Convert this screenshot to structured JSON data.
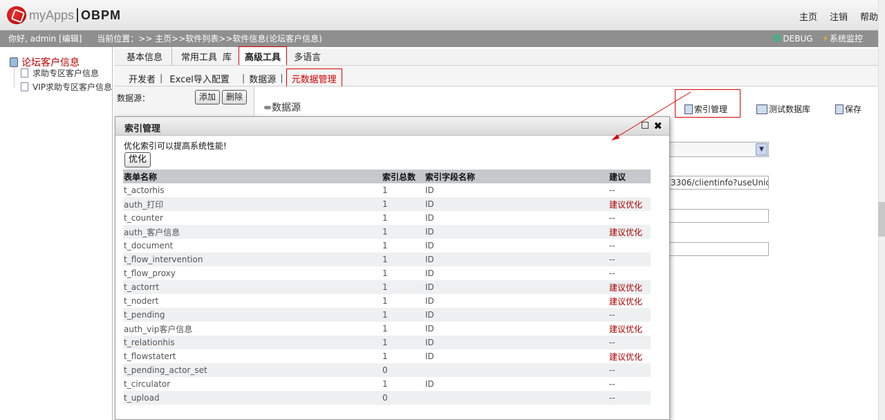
{
  "header": {
    "logo_main": "myApps",
    "logo_product": "OBPM",
    "links": [
      "主页",
      "注销",
      "帮助"
    ]
  },
  "infobar": {
    "greeting": "你好, admin [编辑]",
    "breadcrumb": "当前位置：>> 主页>>软件列表>>软件信息(论坛客户信息)",
    "debug_label": "DEBUG",
    "monitor_label": "系统监控"
  },
  "tree": {
    "root": "论坛客户信息",
    "children": [
      "求助专区客户信息",
      "VIP求助专区客户信息"
    ]
  },
  "tabs": {
    "items": [
      "基本信息",
      "常用工具",
      "库",
      "高级工具",
      "多语言"
    ],
    "active": "高级工具"
  },
  "subtabs": {
    "items": [
      "开发者",
      "Excel导入配置",
      "数据源",
      "元数据管理"
    ],
    "active": "元数据管理"
  },
  "datasource_panel": {
    "label": "数据源：",
    "add_label": "添加",
    "delete_label": "删除"
  },
  "toolbar": {
    "title": "数据源",
    "index_label": "索引管理",
    "test_label": "测试数据库",
    "save_label": "保存"
  },
  "form_bg": {
    "url_value": "3306/clientinfo?useUnicode"
  },
  "dialog": {
    "title": "索引管理",
    "hint": "优化索引可以提高系统性能!",
    "optimize_label": "优化",
    "columns": [
      "表单名称",
      "索引总数",
      "索引字段名称",
      "建议"
    ],
    "rows": [
      {
        "name": "t_actorhis",
        "count": "1",
        "field": "ID",
        "suggest": "--"
      },
      {
        "name": "auth_打印",
        "count": "1",
        "field": "ID",
        "suggest": "建议优化"
      },
      {
        "name": "t_counter",
        "count": "1",
        "field": "ID",
        "suggest": "--"
      },
      {
        "name": "auth_客户信息",
        "count": "1",
        "field": "ID",
        "suggest": "建议优化"
      },
      {
        "name": "t_document",
        "count": "1",
        "field": "ID",
        "suggest": "--"
      },
      {
        "name": "t_flow_intervention",
        "count": "1",
        "field": "ID",
        "suggest": "--"
      },
      {
        "name": "t_flow_proxy",
        "count": "1",
        "field": "ID",
        "suggest": "--"
      },
      {
        "name": "t_actorrt",
        "count": "1",
        "field": "ID",
        "suggest": "建议优化"
      },
      {
        "name": "t_nodert",
        "count": "1",
        "field": "ID",
        "suggest": "建议优化"
      },
      {
        "name": "t_pending",
        "count": "1",
        "field": "ID",
        "suggest": "--"
      },
      {
        "name": "auth_vip客户信息",
        "count": "1",
        "field": "ID",
        "suggest": "建议优化"
      },
      {
        "name": "t_relationhis",
        "count": "1",
        "field": "ID",
        "suggest": "--"
      },
      {
        "name": "t_flowstatert",
        "count": "1",
        "field": "ID",
        "suggest": "建议优化"
      },
      {
        "name": "t_pending_actor_set",
        "count": "0",
        "field": "",
        "suggest": "--"
      },
      {
        "name": "t_circulator",
        "count": "1",
        "field": "ID",
        "suggest": "--"
      },
      {
        "name": "t_upload",
        "count": "0",
        "field": "",
        "suggest": "--"
      }
    ]
  },
  "colors": {
    "accent_red": "#cc0000",
    "suggest_red": "#aa0000",
    "infobar_bg": "#8f8f8f"
  }
}
